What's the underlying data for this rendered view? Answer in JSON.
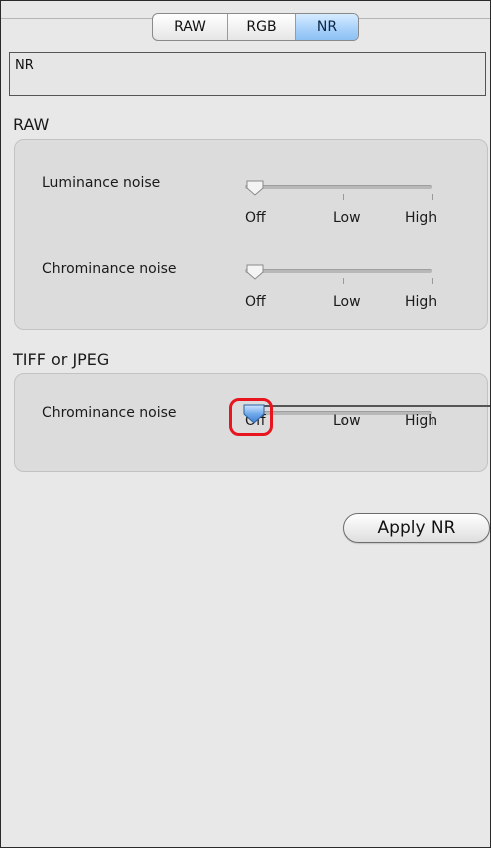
{
  "tabs": [
    {
      "label": "RAW",
      "active": false
    },
    {
      "label": "RGB",
      "active": false
    },
    {
      "label": "NR",
      "active": true
    }
  ],
  "title_field": {
    "value": "NR"
  },
  "raw_section": {
    "label": "RAW",
    "luminance": {
      "label": "Luminance noise",
      "level": 0
    },
    "chrominance": {
      "label": "Chrominance noise",
      "level": 0
    }
  },
  "tiff_section": {
    "label": "TIFF or JPEG",
    "chrominance": {
      "label": "Chrominance noise",
      "level": 0
    }
  },
  "scale_labels": {
    "off": "Off",
    "low": "Low",
    "high": "High"
  },
  "apply_button": {
    "label": "Apply NR"
  },
  "colors": {
    "accent": "#8cc0f3",
    "highlight": "#e8141e"
  }
}
